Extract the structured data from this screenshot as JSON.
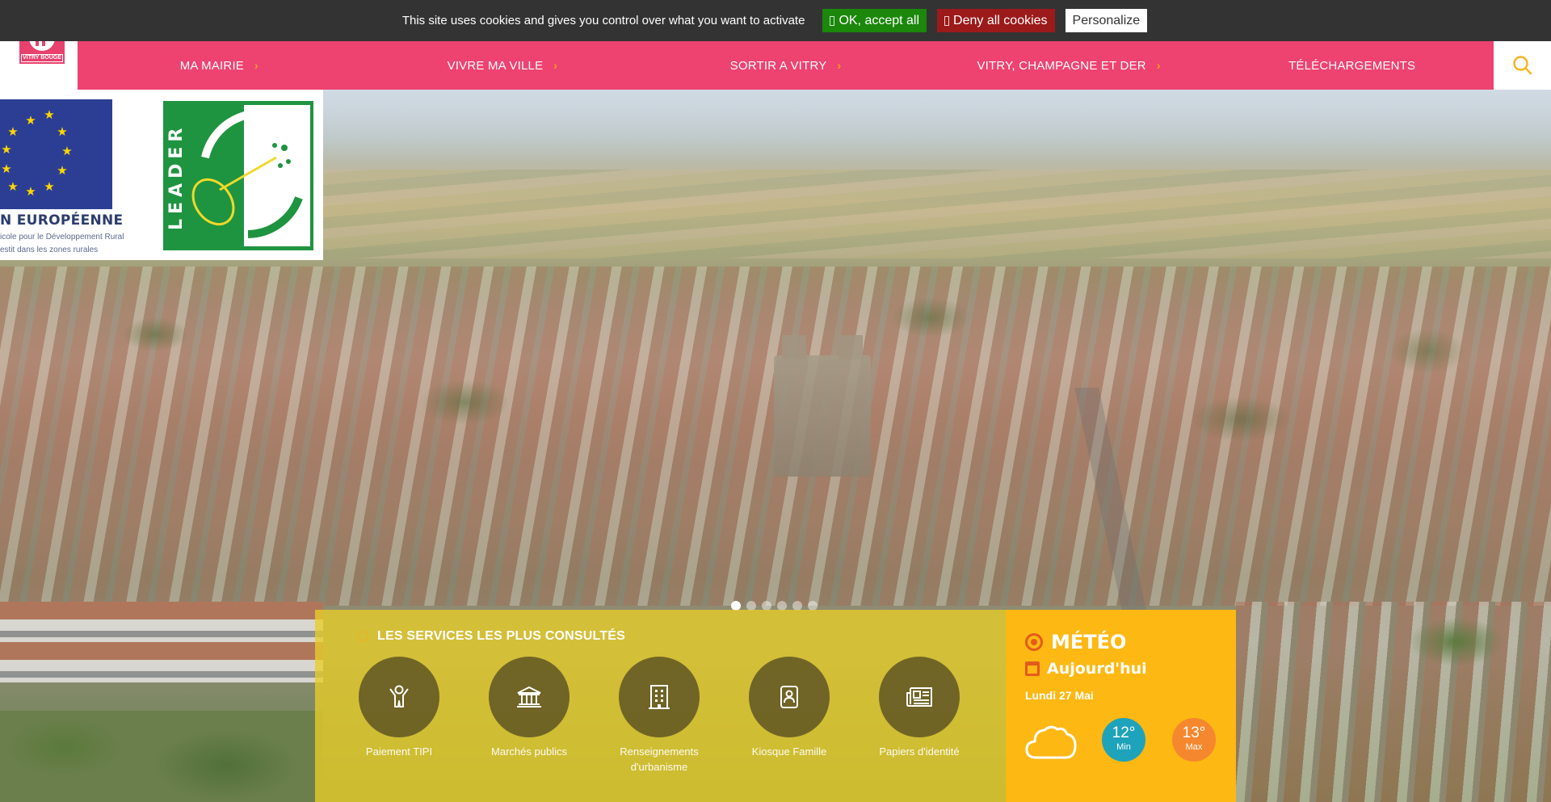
{
  "cookie_banner": {
    "message": "This site uses cookies and gives you control over what you want to activate",
    "accept_label": "OK, accept all",
    "deny_label": "Deny all cookies",
    "personalize_label": "Personalize",
    "colors": {
      "background": "#333333",
      "accept": "#1b870b",
      "deny": "#9c1a1a"
    }
  },
  "header": {
    "logo_text": "VITRY BOUGE",
    "nav": [
      {
        "label": "MA MAIRIE",
        "has_submenu": true
      },
      {
        "label": "VIVRE MA VILLE",
        "has_submenu": true
      },
      {
        "label": "SORTIR A VITRY",
        "has_submenu": true
      },
      {
        "label": "VITRY, CHAMPAGNE ET DER",
        "has_submenu": true
      },
      {
        "label": "TÉLÉCHARGEMENTS",
        "has_submenu": false
      }
    ],
    "search_icon": "search-icon",
    "colors": {
      "nav_background": "#ee4270",
      "accent": "#f6a21e"
    }
  },
  "eu_banner": {
    "title": "N EUROPÉENNE",
    "line1": "icole pour le Développement Rural",
    "line2": "estit dans les zones rurales",
    "leader_text": "LEADER"
  },
  "slider": {
    "dot_count": 6,
    "active_index": 0
  },
  "services": {
    "title": "LES SERVICES LES PLUS CONSULTÉS",
    "items": [
      {
        "label": "Paiement TIPI",
        "icon": "person-arms-up-icon"
      },
      {
        "label": "Marchés publics",
        "icon": "bank-building-icon"
      },
      {
        "label": "Renseignements d'urbanisme",
        "icon": "office-building-icon"
      },
      {
        "label": "Kiosque Famille",
        "icon": "id-badge-icon"
      },
      {
        "label": "Papiers d'identité",
        "icon": "newspaper-icon"
      }
    ]
  },
  "meteo": {
    "title": "MÉTÉO",
    "subtitle": "Aujourd'hui",
    "date": "Lundi 27 Mai",
    "condition_icon": "cloud-icon",
    "min": {
      "value": "12°",
      "label": "Min"
    },
    "max": {
      "value": "13°",
      "label": "Max"
    },
    "colors": {
      "panel": "#fdb813",
      "min": "#1ea3bb",
      "max": "#f5872e",
      "icon_accent": "#e55a1c"
    }
  }
}
